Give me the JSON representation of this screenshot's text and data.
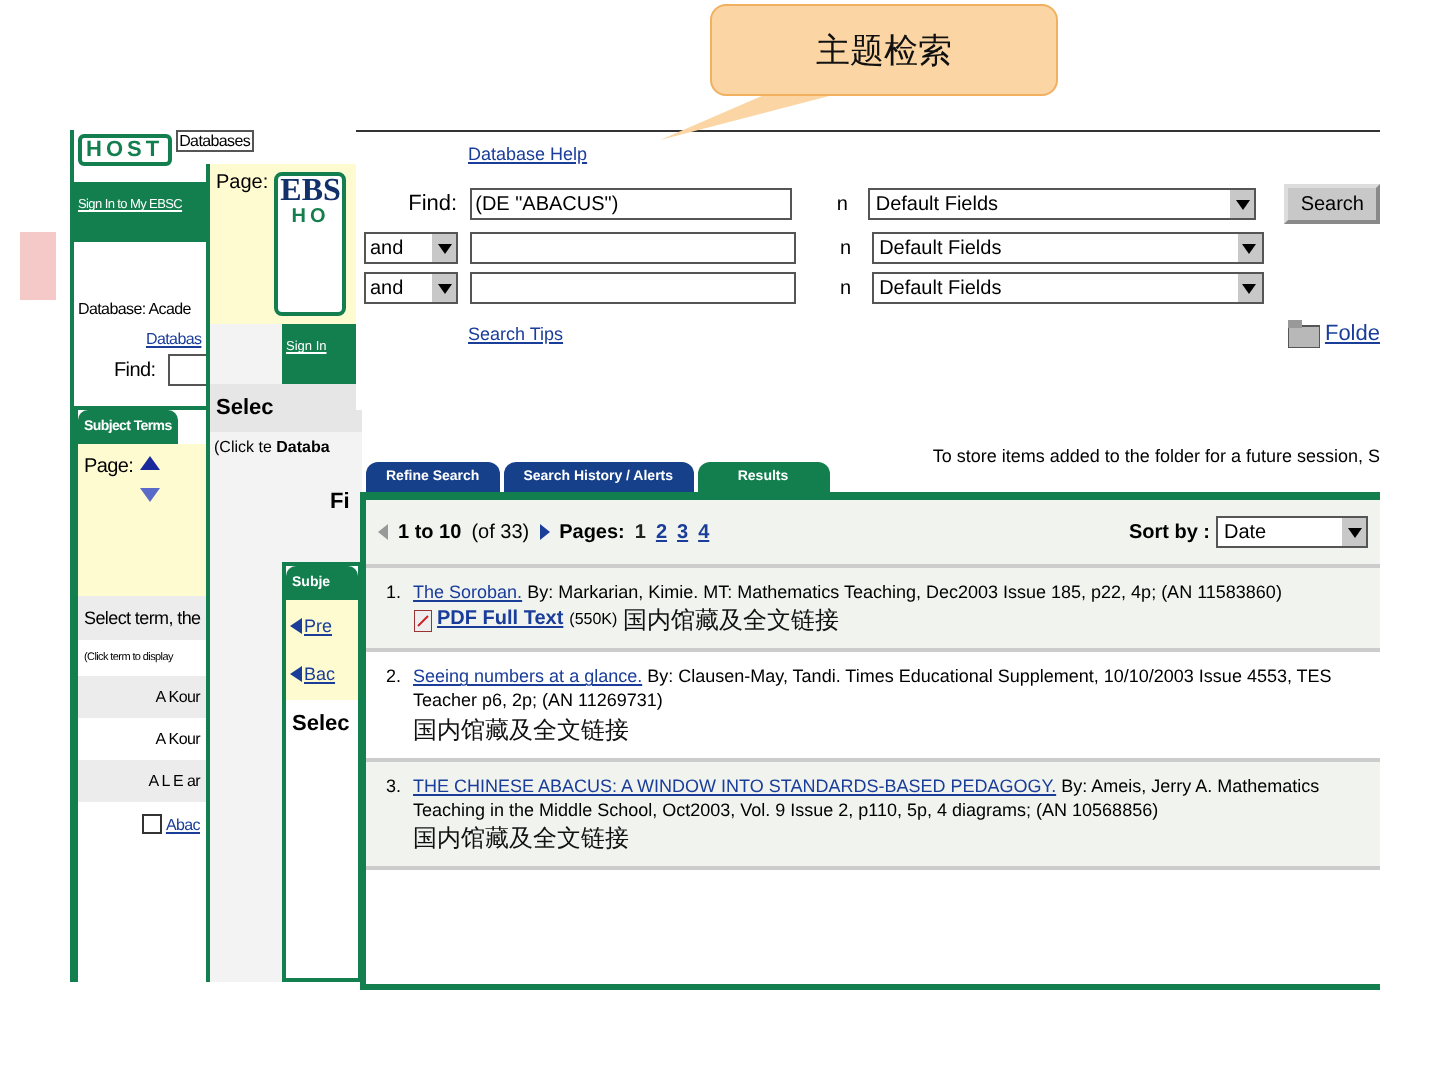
{
  "callout": {
    "text": "主题检索"
  },
  "back_panel": {
    "logo": "HOST",
    "tab": "Databases",
    "sign_in": "Sign In to My EBSC",
    "database_label": "Database:",
    "database_value": "Acade",
    "database_link": "Databas",
    "find_label": "Find:",
    "subject_tab": "Subject Terms",
    "page_label": "Page:",
    "select_text": "Select term, the",
    "click_text": "(Click term to display",
    "terms": [
      {
        "text": "A Kour",
        "kind": "plain"
      },
      {
        "text": "A Kour",
        "kind": "plain"
      },
      {
        "text": "A L E ar",
        "kind": "plain"
      },
      {
        "text": "Abac",
        "kind": "check",
        "checked": false
      }
    ]
  },
  "middle_panel": {
    "page_label": "Page:",
    "logo_top": "EBS",
    "logo_bottom": "HO",
    "sign_in": "Sign In",
    "select_text": "Selec",
    "click_text": "(Click te",
    "database_text": "Databa",
    "find_text": "Fi",
    "subject_tab": "Subje",
    "prev_link": "Pre",
    "back_link": "Bac",
    "select_text_2": "Selec"
  },
  "search_panel": {
    "help_link": "Database Help",
    "rows": [
      {
        "bool": null,
        "label": "Find:",
        "value": "(DE \"ABACUS\")",
        "in": "n",
        "field": "Default Fields",
        "button": "Search"
      },
      {
        "bool": "and",
        "label": null,
        "value": "",
        "in": "n",
        "field": "Default Fields",
        "button": null
      },
      {
        "bool": "and",
        "label": null,
        "value": "",
        "in": "n",
        "field": "Default Fields",
        "button": null
      }
    ],
    "tips_link": "Search Tips",
    "folder_link": "Folde"
  },
  "results": {
    "notice": "To store items added to the folder for a future session, S",
    "tabs": [
      {
        "label": "Refine Search",
        "selected": false
      },
      {
        "label": "Search History / Alerts",
        "selected": false
      },
      {
        "label": "Results",
        "selected": true
      }
    ],
    "range": "1 to 10",
    "of": "(of 33)",
    "pages_label": "Pages:",
    "pages": [
      {
        "label": "1",
        "selected": true
      },
      {
        "label": "2",
        "selected": false
      },
      {
        "label": "3",
        "selected": false
      },
      {
        "label": "4",
        "selected": false
      }
    ],
    "sort_label": "Sort by :",
    "sort_value": "Date",
    "items": [
      {
        "number": "1.",
        "title": "The Soroban.",
        "details": "By: Markarian, Kimie. MT: Mathematics Teaching, Dec2003 Issue 185, p22, 4p; (AN 11583860)",
        "pdf": "PDF Full Text",
        "pdf_size": "(550K)",
        "holdings": "国内馆藏及全文链接"
      },
      {
        "number": "2.",
        "title": "Seeing numbers at a glance.",
        "details": "By: Clausen-May, Tandi. Times Educational Supplement, 10/10/2003 Issue 4553, TES Teacher p6, 2p; (AN 11269731)",
        "holdings": "国内馆藏及全文链接"
      },
      {
        "number": "3.",
        "title": "THE CHINESE ABACUS: A WINDOW INTO STANDARDS-BASED PEDAGOGY.",
        "details": "By: Ameis, Jerry A. Mathematics Teaching in the Middle School, Oct2003, Vol. 9 Issue 2, p110, 5p, 4 diagrams; (AN 10568856)",
        "holdings": "国内馆藏及全文链接"
      }
    ]
  }
}
